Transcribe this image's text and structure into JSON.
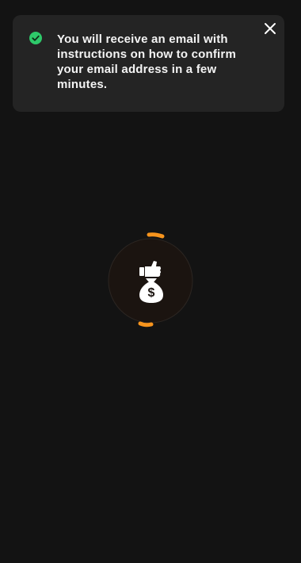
{
  "toast": {
    "message": "You will receive an email with instructions on how to confirm your email address in a few minutes.",
    "status_icon": "check-circle-icon",
    "close_icon": "close-icon",
    "status_color": "#2ec96a"
  },
  "loader": {
    "icon": "money-bag-icon",
    "accent_color": "#f7941d",
    "bag_symbol": "$"
  }
}
